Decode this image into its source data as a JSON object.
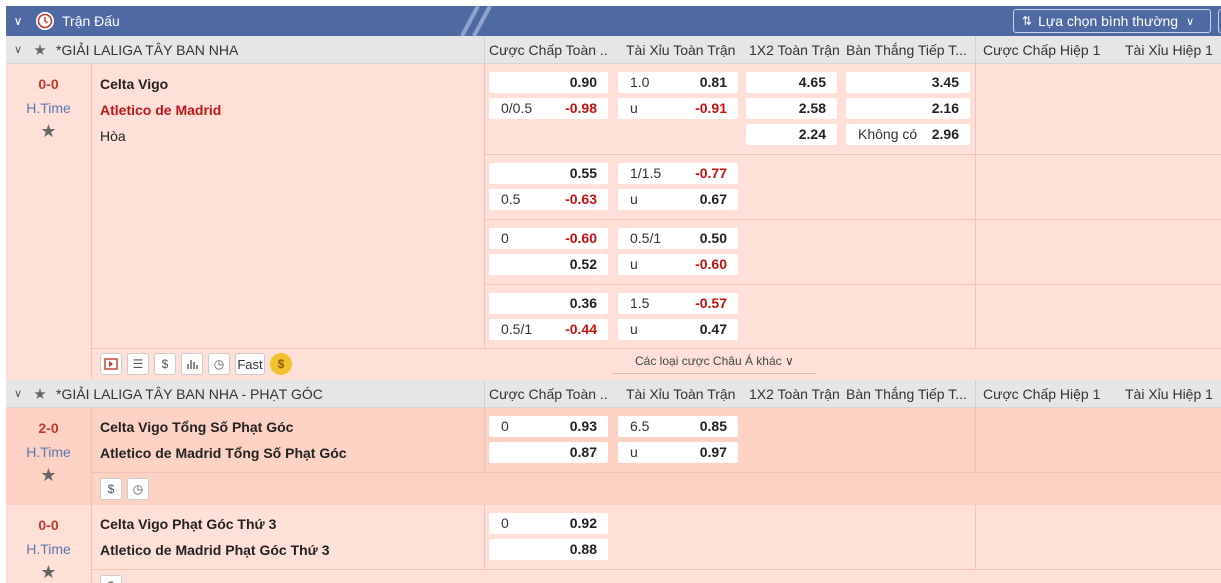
{
  "header": {
    "title": "Trận Đấu",
    "selector_label": "Lựa chọn bình thường"
  },
  "columns": [
    "Cược Chấp Toàn ...",
    "Tài Xỉu Toàn Trận",
    "1X2 Toàn Trận",
    "Bàn Thắng Tiếp T...",
    "Cược Chấp Hiệp 1",
    "Tài Xỉu Hiệp 1"
  ],
  "leagues": [
    {
      "name": "*GIẢI LALIGA TÂY BAN NHA"
    },
    {
      "name": "*GIẢI LALIGA TÂY BAN NHA - PHẠT GÓC"
    }
  ],
  "match1": {
    "score": "0-0",
    "status": "H.Time",
    "home": "Celta Vigo",
    "away": "Atletico de Madrid",
    "draw": "Hòa",
    "rows": [
      {
        "h1": {
          "line": "",
          "odds": "0.90"
        },
        "h2": {
          "line": "0/0.5",
          "odds": "-0.98"
        },
        "t1": {
          "line": "1.0",
          "odds": "0.81"
        },
        "t2": {
          "line": "u",
          "odds": "-0.91"
        }
      },
      {
        "h1": {
          "line": "",
          "odds": "0.55"
        },
        "h2": {
          "line": "0.5",
          "odds": "-0.63"
        },
        "t1": {
          "line": "1/1.5",
          "odds": "-0.77"
        },
        "t2": {
          "line": "u",
          "odds": "0.67"
        }
      },
      {
        "h1": {
          "line": "0",
          "odds": "-0.60"
        },
        "h2": {
          "line": "",
          "odds": "0.52"
        },
        "t1": {
          "line": "0.5/1",
          "odds": "0.50"
        },
        "t2": {
          "line": "u",
          "odds": "-0.60"
        }
      },
      {
        "h1": {
          "line": "",
          "odds": "0.36"
        },
        "h2": {
          "line": "0.5/1",
          "odds": "-0.44"
        },
        "t1": {
          "line": "1.5",
          "odds": "-0.57"
        },
        "t2": {
          "line": "u",
          "odds": "0.47"
        }
      }
    ],
    "x12": [
      "4.65",
      "2.58",
      "2.24"
    ],
    "next_goal": [
      {
        "label": "",
        "odds": "3.45"
      },
      {
        "label": "",
        "odds": "2.16"
      },
      {
        "label": "Không có",
        "odds": "2.96"
      }
    ],
    "fast_label": "Fast",
    "asia_more": "Các loại cược Châu Á khác"
  },
  "match2": {
    "score": "2-0",
    "status": "H.Time",
    "home": "Celta Vigo Tổng Số Phạt Góc",
    "away": "Atletico de Madrid Tổng Số Phạt Góc",
    "h1": {
      "line": "0",
      "odds": "0.93"
    },
    "h2": {
      "line": "",
      "odds": "0.87"
    },
    "t1": {
      "line": "6.5",
      "odds": "0.85"
    },
    "t2": {
      "line": "u",
      "odds": "0.97"
    }
  },
  "match3": {
    "score": "0-0",
    "status": "H.Time",
    "home": "Celta Vigo Phạt Góc Thứ 3",
    "away": "Atletico de Madrid Phạt Góc Thứ 3",
    "h1": {
      "line": "0",
      "odds": "0.92"
    },
    "h2": {
      "line": "",
      "odds": "0.88"
    }
  },
  "icons": {
    "collapse": "chevron-down-icon",
    "clock": "clock-icon",
    "star": "star-icon",
    "filter": "filter-icon"
  }
}
